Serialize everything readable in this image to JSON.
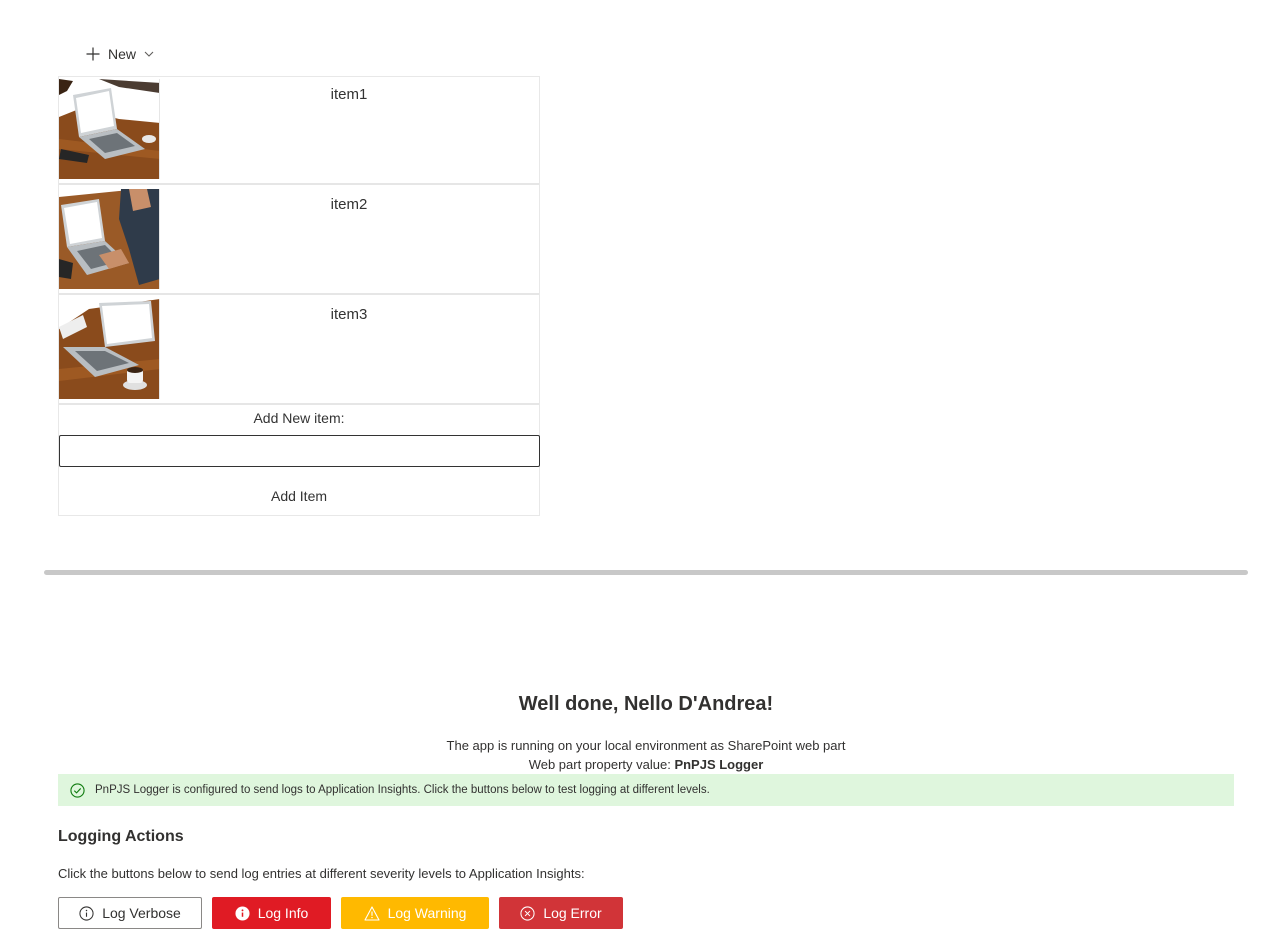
{
  "command_bar": {
    "new_label": "New"
  },
  "items": [
    {
      "title": "item1"
    },
    {
      "title": "item2"
    },
    {
      "title": "item3"
    }
  ],
  "add_form": {
    "label": "Add New item:",
    "input_value": "",
    "button_label": "Add Item"
  },
  "welcome": {
    "title": "Well done, Nello D'Andrea!",
    "environment_text": "The app is running on your local environment as SharePoint web part",
    "property_prefix": "Web part property value: ",
    "property_value": "PnPJS Logger"
  },
  "success_message": "PnPJS Logger is configured to send logs to Application Insights. Click the buttons below to test logging at different levels.",
  "logging": {
    "heading": "Logging Actions",
    "description": "Click the buttons below to send log entries at different severity levels to Application Insights:",
    "buttons": {
      "verbose": "Log Verbose",
      "info": "Log Info",
      "warning": "Log Warning",
      "error": "Log Error"
    }
  },
  "colors": {
    "info": "#e01b24",
    "warning": "#ffb900",
    "error": "#d13438",
    "success_bg": "#dff6dd",
    "success_icon": "#107c10"
  },
  "icons": {
    "new": "plus-icon",
    "new_menu": "chevron-down-icon",
    "success": "check-circle-icon",
    "verbose": "info-outline-icon",
    "info": "info-filled-icon",
    "warning": "warning-icon",
    "error": "error-circle-icon"
  }
}
